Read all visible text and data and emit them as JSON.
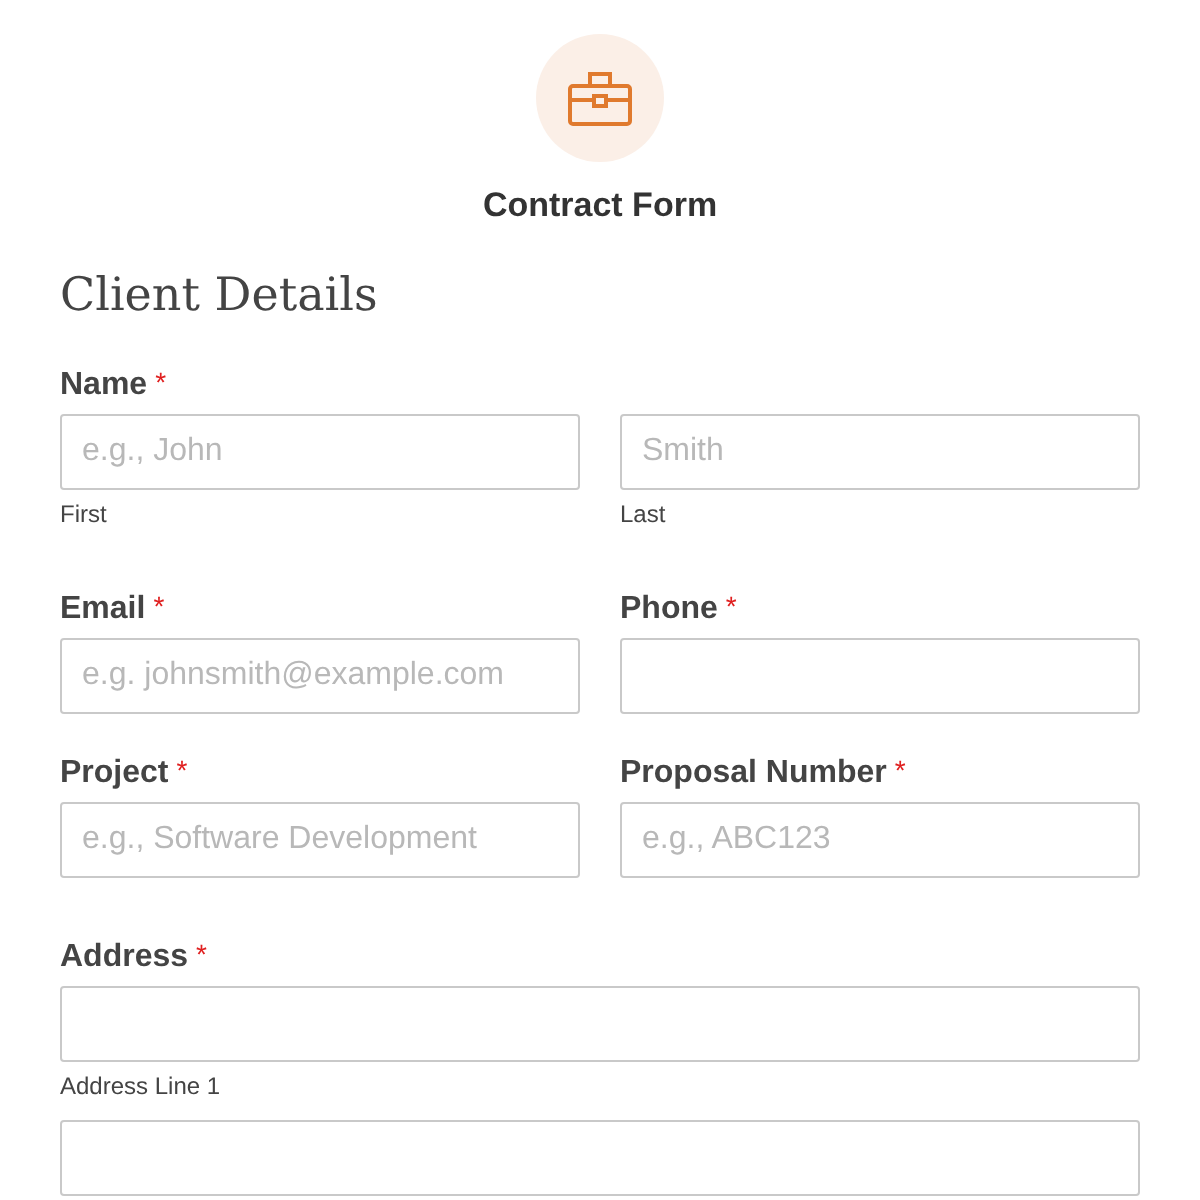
{
  "form": {
    "title": "Contract Form"
  },
  "section": {
    "heading": "Client Details"
  },
  "rows": [
    {
      "fields": [
        {
          "label": "Name",
          "required_mark": "*",
          "kind": "split",
          "inputs": [
            {
              "kind": "text",
              "placeholder": "e.g., John",
              "sublabel": "First"
            },
            {
              "kind": "text",
              "placeholder": "Smith",
              "sublabel": "Last"
            }
          ]
        }
      ]
    },
    {
      "fields": [
        {
          "label": "Email",
          "required_mark": "*",
          "kind": "stack",
          "inputs": [
            {
              "kind": "text",
              "placeholder": "e.g. johnsmith@example.com"
            }
          ]
        },
        {
          "label": "Phone",
          "required_mark": "*",
          "kind": "stack",
          "inputs": [
            {
              "kind": "text"
            }
          ]
        }
      ]
    },
    {
      "fields": [
        {
          "label": "Project",
          "required_mark": "*",
          "kind": "stack",
          "inputs": [
            {
              "kind": "text",
              "placeholder": "e.g., Software Development"
            }
          ]
        },
        {
          "label": "Proposal Number",
          "required_mark": "*",
          "kind": "stack",
          "inputs": [
            {
              "kind": "text",
              "placeholder": "e.g., ABC123"
            }
          ]
        }
      ]
    },
    {
      "fields": [
        {
          "label": "Address",
          "required_mark": "*",
          "kind": "stack",
          "inputs": [
            {
              "kind": "text",
              "sublabel": "Address Line 1"
            },
            {
              "kind": "text"
            }
          ]
        }
      ]
    }
  ]
}
